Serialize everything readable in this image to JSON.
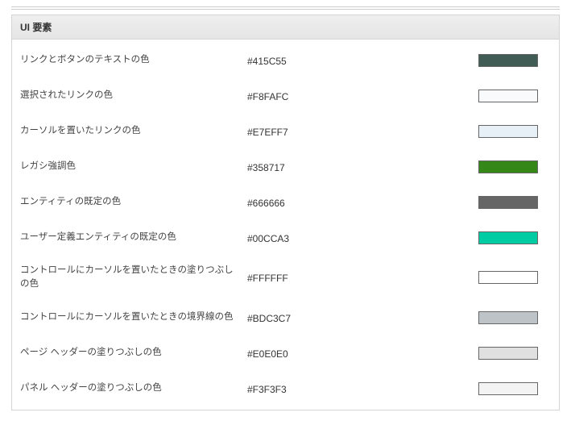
{
  "panel": {
    "title": "UI 要素"
  },
  "rows": [
    {
      "label": "リンクとボタンのテキストの色",
      "hex": "#415C55",
      "swatch": "#415C55"
    },
    {
      "label": "選択されたリンクの色",
      "hex": "#F8FAFC",
      "swatch": "#F8FAFC"
    },
    {
      "label": "カーソルを置いたリンクの色",
      "hex": "#E7EFF7",
      "swatch": "#E7EFF7"
    },
    {
      "label": "レガシ強調色",
      "hex": "#358717",
      "swatch": "#358717"
    },
    {
      "label": "エンティティの既定の色",
      "hex": "#666666",
      "swatch": "#666666"
    },
    {
      "label": "ユーザー定義エンティティの既定の色",
      "hex": "#00CCA3",
      "swatch": "#00CCA3"
    },
    {
      "label": "コントロールにカーソルを置いたときの塗りつぶしの色",
      "hex": "#FFFFFF",
      "swatch": "#FFFFFF"
    },
    {
      "label": "コントロールにカーソルを置いたときの境界線の色",
      "hex": "#BDC3C7",
      "swatch": "#BDC3C7"
    },
    {
      "label": "ページ ヘッダーの塗りつぶしの色",
      "hex": "#E0E0E0",
      "swatch": "#E0E0E0"
    },
    {
      "label": "パネル ヘッダーの塗りつぶしの色",
      "hex": "#F3F3F3",
      "swatch": "#F3F3F3"
    }
  ]
}
